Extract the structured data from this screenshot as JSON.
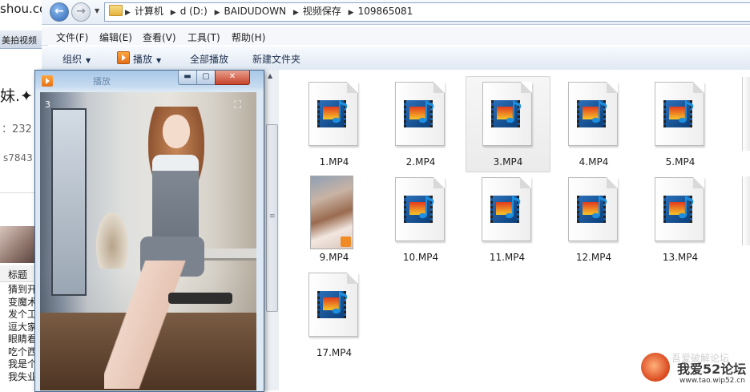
{
  "background_browser": {
    "url_fragment": "shou.co",
    "tab_label": "美拍视频",
    "post_title": "妹.✦",
    "view_count": "：232",
    "user_id": "s7843",
    "column_header": "标题",
    "rows": [
      "猜到开",
      "变魔术",
      "发个工",
      "逗大家",
      "眼睛看",
      "吃个西",
      "我是个",
      "我失业"
    ]
  },
  "explorer": {
    "breadcrumb": [
      "计算机",
      "d (D:)",
      "BAIDUDOWN",
      "视频保存",
      "109865081"
    ],
    "menu": [
      "文件(F)",
      "编辑(E)",
      "查看(V)",
      "工具(T)",
      "帮助(H)"
    ],
    "toolbar": {
      "organize": "组织",
      "play": "播放",
      "play_all": "全部播放",
      "new_folder": "新建文件夹"
    },
    "files": [
      {
        "name": "1.MP4",
        "kind": "media"
      },
      {
        "name": "2.MP4",
        "kind": "media"
      },
      {
        "name": "3.MP4",
        "kind": "media",
        "selected": true
      },
      {
        "name": "4.MP4",
        "kind": "media"
      },
      {
        "name": "5.MP4",
        "kind": "media"
      },
      {
        "name": "9.MP4",
        "kind": "thumbnail"
      },
      {
        "name": "10.MP4",
        "kind": "media"
      },
      {
        "name": "11.MP4",
        "kind": "media"
      },
      {
        "name": "12.MP4",
        "kind": "media"
      },
      {
        "name": "13.MP4",
        "kind": "media"
      },
      {
        "name": "17.MP4",
        "kind": "media"
      }
    ]
  },
  "player": {
    "title": "播放",
    "counter": "3",
    "minimize": "▬",
    "maximize": "▢",
    "close": "✕"
  },
  "watermark": {
    "brand": "我爱52论坛",
    "url": "www.tao.wip52.cn",
    "faded_text": "吾爱破解论坛"
  }
}
